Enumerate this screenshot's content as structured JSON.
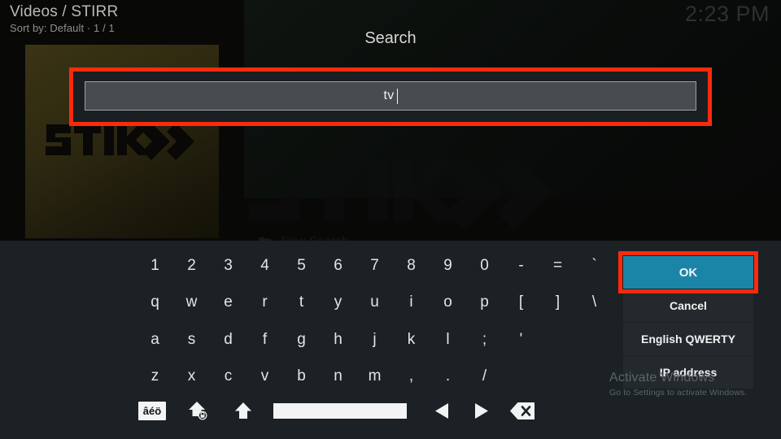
{
  "header": {
    "title": "Videos / STIRR",
    "subtitle": "Sort by: Default  ·  1 / 1",
    "clock": "2:23 PM"
  },
  "background": {
    "poster_label": "STIRR",
    "new_search_label": "New Search",
    "folder_icon": "folder-icon",
    "watermark_logo": "stirr-logo"
  },
  "dialog": {
    "title": "Search",
    "input": {
      "value": "tv",
      "placeholder": "",
      "caret": true
    }
  },
  "keyboard": {
    "rows": [
      [
        "1",
        "2",
        "3",
        "4",
        "5",
        "6",
        "7",
        "8",
        "9",
        "0",
        "-",
        "=",
        "`"
      ],
      [
        "q",
        "w",
        "e",
        "r",
        "t",
        "y",
        "u",
        "i",
        "o",
        "p",
        "[",
        "]",
        "\\"
      ],
      [
        "a",
        "s",
        "d",
        "f",
        "g",
        "h",
        "j",
        "k",
        "l",
        ";",
        "'"
      ],
      [
        "z",
        "x",
        "c",
        "v",
        "b",
        "n",
        "m",
        ",",
        ".",
        "/"
      ]
    ],
    "function_row": {
      "accent_label": "âéö",
      "capslock_icon": "caps-lock-icon",
      "shift_icon": "shift-icon",
      "space_label": "",
      "left_icon": "arrow-left-icon",
      "right_icon": "arrow-right-icon",
      "backspace_icon": "backspace-icon"
    }
  },
  "actions": [
    {
      "label": "OK",
      "primary": true
    },
    {
      "label": "Cancel",
      "primary": false
    },
    {
      "label": "English QWERTY",
      "primary": false
    },
    {
      "label": "IP address",
      "primary": false
    }
  ],
  "watermark": {
    "title": "Activate Windows",
    "subtitle": "Go to Settings to activate Windows."
  },
  "colors": {
    "accent_blue": "#1b85a8",
    "annotation_red": "#fc2a0c",
    "keyboard_bg": "#1b2125",
    "input_bg": "#474c51"
  }
}
